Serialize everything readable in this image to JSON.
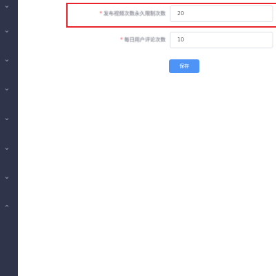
{
  "sidebar": {
    "chevrons": [
      {
        "icon": "chevron-down-icon",
        "glyph": "⌄"
      },
      {
        "icon": "chevron-down-icon",
        "glyph": "⌄"
      },
      {
        "icon": "chevron-down-icon",
        "glyph": "⌄"
      },
      {
        "icon": "chevron-down-icon",
        "glyph": "⌄"
      },
      {
        "icon": "chevron-down-icon",
        "glyph": "⌄"
      },
      {
        "icon": "chevron-down-icon",
        "glyph": "⌄"
      },
      {
        "icon": "chevron-down-icon",
        "glyph": "⌄"
      },
      {
        "icon": "chevron-up-icon",
        "glyph": "⌃"
      }
    ],
    "background_color": "#30344a"
  },
  "form": {
    "fields": [
      {
        "required_mark": "*",
        "label": "发布视频次数永久限制次数",
        "value": "20"
      },
      {
        "required_mark": "*",
        "label": "每日用户评论次数",
        "value": "10"
      }
    ],
    "save_label": "保存"
  },
  "colors": {
    "accent": "#4e94f7",
    "highlight": "#e8212a",
    "required": "#f04848"
  }
}
